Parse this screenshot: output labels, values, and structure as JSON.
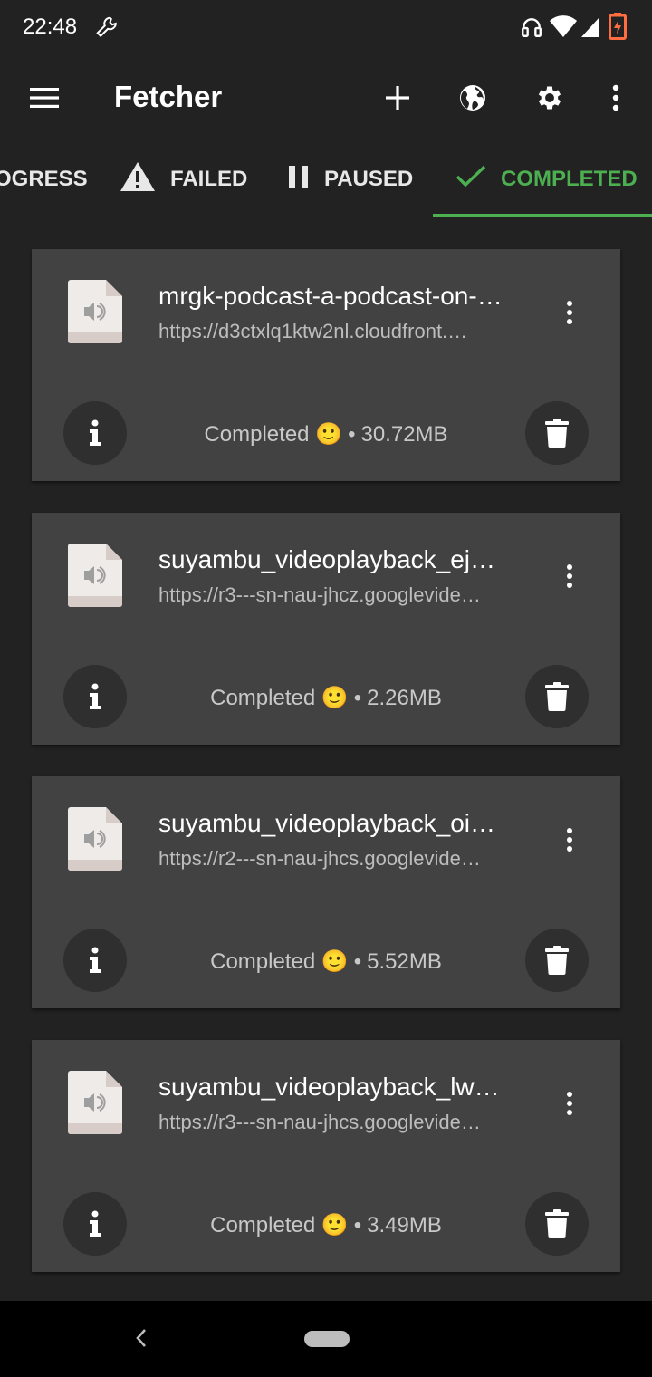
{
  "status_bar": {
    "time": "22:48",
    "icons": [
      "wrench-icon",
      "headphones-icon",
      "wifi-icon",
      "signal-icon",
      "battery-icon"
    ]
  },
  "app_bar": {
    "title": "Fetcher",
    "actions": [
      "add-icon",
      "globe-icon",
      "gear-icon",
      "more-vert-icon"
    ]
  },
  "tabs": [
    {
      "label": "OGRESS",
      "icon": "none",
      "active": false
    },
    {
      "label": "FAILED",
      "icon": "warning-icon",
      "active": false
    },
    {
      "label": "PAUSED",
      "icon": "pause-icon",
      "active": false
    },
    {
      "label": "COMPLETED",
      "icon": "check-icon",
      "active": true
    }
  ],
  "colors": {
    "accent": "#4caf50",
    "background": "#222222",
    "card": "#424242"
  },
  "downloads": [
    {
      "title": "mrgk-podcast-a-podcast-on-…",
      "url": "https://d3ctxlq1ktw2nl.cloudfront.…",
      "status": "Completed 🙂",
      "size": "30.72MB"
    },
    {
      "title": "suyambu_videoplayback_ej…",
      "url": "https://r3---sn-nau-jhcz.googlevide…",
      "status": "Completed 🙂",
      "size": "2.26MB"
    },
    {
      "title": "suyambu_videoplayback_oi…",
      "url": "https://r2---sn-nau-jhcs.googlevide…",
      "status": "Completed 🙂",
      "size": "5.52MB"
    },
    {
      "title": "suyambu_videoplayback_lw…",
      "url": "https://r3---sn-nau-jhcs.googlevide…",
      "status": "Completed 🙂",
      "size": "3.49MB"
    }
  ],
  "separator": "•"
}
